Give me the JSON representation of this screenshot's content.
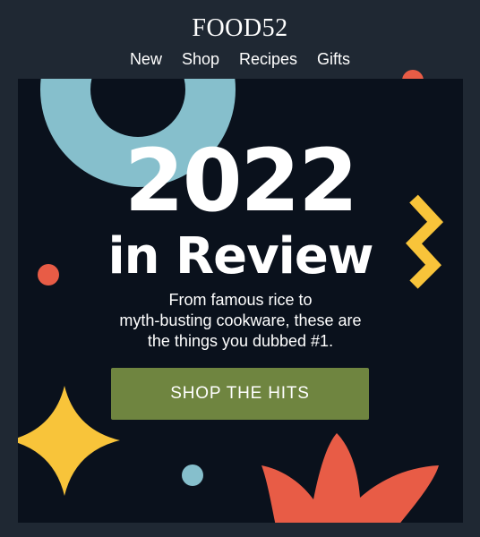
{
  "brand": {
    "logo_text": "FOOD52"
  },
  "nav": {
    "items": [
      {
        "label": "New"
      },
      {
        "label": "Shop"
      },
      {
        "label": "Recipes"
      },
      {
        "label": "Gifts"
      }
    ]
  },
  "hero": {
    "year": "2022",
    "subtitle": "in Review",
    "description_lines": [
      "From famous rice to",
      "myth-busting cookware, these are",
      "the things you dubbed #1."
    ],
    "cta_label": "SHOP THE HITS"
  },
  "colors": {
    "page_bg": "#1f2833",
    "hero_bg": "#0a111c",
    "cta": "#6f8540",
    "light_blue": "#86bfcc",
    "coral": "#e85c46",
    "yellow": "#f8c43a"
  }
}
